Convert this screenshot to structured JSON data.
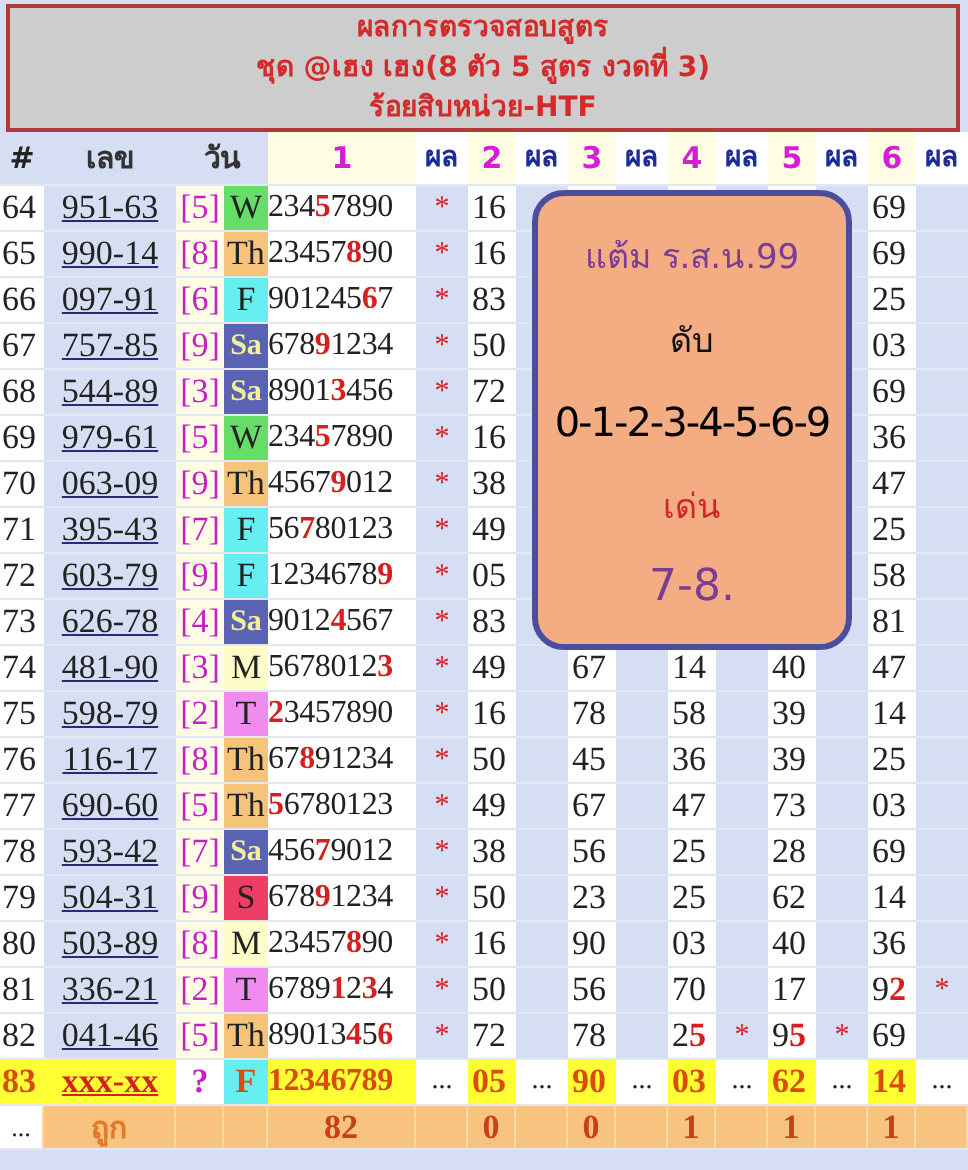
{
  "title": {
    "lines": [
      "ผลการตรวจสอบสูตร",
      "ชุด @เฮง เฮง(8 ตัว 5 สูตร งวดที่ 3)",
      "ร้อยสิบหน่วย-HTF"
    ]
  },
  "header": [
    {
      "label": "#",
      "kind": "index"
    },
    {
      "label": "เลข",
      "kind": "number"
    },
    {
      "label": "วัน",
      "kind": "day"
    },
    {
      "label": "1",
      "kind": "set"
    },
    {
      "label": "ผล",
      "kind": "result"
    },
    {
      "label": "2",
      "kind": "set"
    },
    {
      "label": "ผล",
      "kind": "result"
    },
    {
      "label": "3",
      "kind": "set"
    },
    {
      "label": "ผล",
      "kind": "result"
    },
    {
      "label": "4",
      "kind": "set"
    },
    {
      "label": "ผล",
      "kind": "result"
    },
    {
      "label": "5",
      "kind": "set"
    },
    {
      "label": "ผล",
      "kind": "result"
    },
    {
      "label": "6",
      "kind": "set"
    },
    {
      "label": "ผล",
      "kind": "result"
    }
  ],
  "rows": [
    {
      "kind": "past",
      "index": "64",
      "number": "951-63",
      "bracket": "[5]",
      "day": "W",
      "color": "#66dd66",
      "digits": "234**5**7890",
      "mark": "*",
      "result_2": {
        "value": "16"
      },
      "result_6": {
        "value": "69"
      }
    },
    {
      "kind": "past",
      "index": "65",
      "number": "990-14",
      "bracket": "[8]",
      "day": "Th",
      "color": "#f6c37a",
      "digits": "23457**8**90",
      "mark": "*",
      "result_2": {
        "value": "16"
      },
      "result_6": {
        "value": "69"
      }
    },
    {
      "kind": "past",
      "index": "66",
      "number": "097-91",
      "bracket": "[6]",
      "day": "F",
      "color": "#66eef0",
      "digits": "901245**6**7",
      "mark": "*",
      "result_2": {
        "value": "83"
      },
      "result_6": {
        "value": "25"
      }
    },
    {
      "kind": "past",
      "index": "67",
      "number": "757-85",
      "bracket": "[9]",
      "day": "Sa",
      "color": "#5a62b4",
      "digits": "678**9**1234",
      "mark": "*",
      "result_2": {
        "value": "50"
      },
      "result_6": {
        "value": "03"
      }
    },
    {
      "kind": "past",
      "index": "68",
      "number": "544-89",
      "bracket": "[3]",
      "day": "Sa",
      "color": "#5a62b4",
      "digits": "8901**3**456",
      "mark": "*",
      "result_2": {
        "value": "72"
      },
      "result_6": {
        "value": "69"
      }
    },
    {
      "kind": "past",
      "index": "69",
      "number": "979-61",
      "bracket": "[5]",
      "day": "W",
      "color": "#66dd66",
      "digits": "234**5**7890",
      "mark": "*",
      "result_2": {
        "value": "16"
      },
      "result_6": {
        "value": "36"
      }
    },
    {
      "kind": "past",
      "index": "70",
      "number": "063-09",
      "bracket": "[9]",
      "day": "Th",
      "color": "#f6c37a",
      "digits": "4567**9**012",
      "mark": "*",
      "result_2": {
        "value": "38"
      },
      "result_6": {
        "value": "47"
      }
    },
    {
      "kind": "past",
      "index": "71",
      "number": "395-43",
      "bracket": "[7]",
      "day": "F",
      "color": "#66eef0",
      "digits": "56**7**80123",
      "mark": "*",
      "result_2": {
        "value": "49"
      },
      "result_6": {
        "value": "25"
      }
    },
    {
      "kind": "past",
      "index": "72",
      "number": "603-79",
      "bracket": "[9]",
      "day": "F",
      "color": "#66eef0",
      "digits": "1234678**9**",
      "mark": "*",
      "result_2": {
        "value": "05"
      },
      "result_6": {
        "value": "58"
      }
    },
    {
      "kind": "past",
      "index": "73",
      "number": "626-78",
      "bracket": "[4]",
      "day": "Sa",
      "color": "#5a62b4",
      "digits": "9012**4**567",
      "mark": "*",
      "result_2": {
        "value": "83"
      },
      "result_6": {
        "value": "81"
      }
    },
    {
      "kind": "past",
      "index": "74",
      "number": "481-90",
      "bracket": "[3]",
      "day": "M",
      "color": "#fdfbc8",
      "digits": "5678012**3**",
      "mark": "*",
      "result_2": {
        "value": "49"
      },
      "result_3": {
        "value": "67"
      },
      "result_4": {
        "value": "14"
      },
      "result_5": {
        "value": "40"
      },
      "result_6": {
        "value": "47"
      }
    },
    {
      "kind": "past",
      "index": "75",
      "number": "598-79",
      "bracket": "[2]",
      "day": "T",
      "color": "#f08cf0",
      "digits": "**2**3457890",
      "mark": "*",
      "result_2": {
        "value": "16"
      },
      "result_3": {
        "value": "78"
      },
      "result_4": {
        "value": "58"
      },
      "result_5": {
        "value": "39"
      },
      "result_6": {
        "value": "14"
      }
    },
    {
      "kind": "past",
      "index": "76",
      "number": "116-17",
      "bracket": "[8]",
      "day": "Th",
      "color": "#f6c37a",
      "digits": "67**8**91234",
      "mark": "*",
      "result_2": {
        "value": "50"
      },
      "result_3": {
        "value": "45"
      },
      "result_4": {
        "value": "36"
      },
      "result_5": {
        "value": "39"
      },
      "result_6": {
        "value": "25"
      }
    },
    {
      "kind": "past",
      "index": "77",
      "number": "690-60",
      "bracket": "[5]",
      "day": "Th",
      "color": "#f6c37a",
      "digits": "**5**6780123",
      "mark": "*",
      "result_2": {
        "value": "49"
      },
      "result_3": {
        "value": "67"
      },
      "result_4": {
        "value": "47"
      },
      "result_5": {
        "value": "73"
      },
      "result_6": {
        "value": "03"
      }
    },
    {
      "kind": "past",
      "index": "78",
      "number": "593-42",
      "bracket": "[7]",
      "day": "Sa",
      "color": "#5a62b4",
      "digits": "456**7**9012",
      "mark": "*",
      "result_2": {
        "value": "38"
      },
      "result_3": {
        "value": "56"
      },
      "result_4": {
        "value": "25"
      },
      "result_5": {
        "value": "28"
      },
      "result_6": {
        "value": "69"
      }
    },
    {
      "kind": "past",
      "index": "79",
      "number": "504-31",
      "bracket": "[9]",
      "day": "S",
      "color": "#ee3e64",
      "digits": "678**9**1234",
      "mark": "*",
      "result_2": {
        "value": "50"
      },
      "result_3": {
        "value": "23"
      },
      "result_4": {
        "value": "25"
      },
      "result_5": {
        "value": "62"
      },
      "result_6": {
        "value": "14"
      }
    },
    {
      "kind": "past",
      "index": "80",
      "number": "503-89",
      "bracket": "[8]",
      "day": "M",
      "color": "#fdfbc8",
      "digits": "23457**8**90",
      "mark": "*",
      "result_2": {
        "value": "16"
      },
      "result_3": {
        "value": "90"
      },
      "result_4": {
        "value": "03"
      },
      "result_5": {
        "value": "40"
      },
      "result_6": {
        "value": "36"
      }
    },
    {
      "kind": "past",
      "index": "81",
      "number": "336-21",
      "bracket": "[2]",
      "day": "T",
      "color": "#f08cf0",
      "digits": "6789**1**2**3**4",
      "mark": "*",
      "result_2": {
        "value": "50"
      },
      "result_3": {
        "value": "56"
      },
      "result_4": {
        "value": "70"
      },
      "result_5": {
        "value": "17"
      },
      "result_6": {
        "value": "9**2**",
        "mark": "*"
      }
    },
    {
      "kind": "past",
      "index": "82",
      "number": "041-46",
      "bracket": "[5]",
      "day": "Th",
      "color": "#f6c37a",
      "digits": "89013**4**5**6**",
      "mark": "*",
      "result_2": {
        "value": "72"
      },
      "result_3": {
        "value": "78"
      },
      "result_4": {
        "value": "2**5**",
        "mark": "*"
      },
      "result_5": {
        "value": "9**5**",
        "mark": "*"
      },
      "result_6": {
        "value": "69"
      }
    },
    {
      "kind": "next",
      "index": "83",
      "number": "xxx-xx",
      "bracket": "?",
      "day": "F",
      "color": "#66eef0",
      "digits": "12346789",
      "mark": "...",
      "result_2": {
        "value": "05",
        "mark": "..."
      },
      "result_3": {
        "value": "90",
        "mark": "..."
      },
      "result_4": {
        "value": "03",
        "mark": "..."
      },
      "result_5": {
        "value": "62",
        "mark": "..."
      },
      "result_6": {
        "value": "14",
        "mark": "..."
      }
    }
  ],
  "total_row": {
    "index": "...",
    "label": "ถูก",
    "count": "82",
    "results": [
      "0",
      "0",
      "1",
      "1",
      "1"
    ]
  },
  "note": {
    "lines": [
      {
        "text": "แต้ม ร.ส.น.99",
        "kind": "heading"
      },
      {
        "text": "ดับ",
        "kind": "label"
      },
      {
        "text": "0-1-2-3-4-5-6-9",
        "kind": "digits"
      },
      {
        "text": "เด่น",
        "kind": "accent"
      },
      {
        "text": "7-8.",
        "kind": "highlight"
      }
    ]
  }
}
